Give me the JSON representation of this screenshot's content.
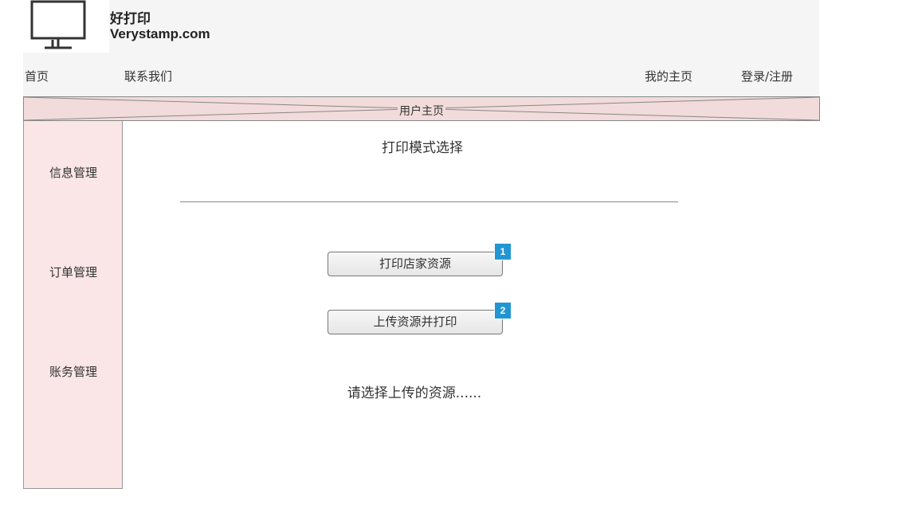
{
  "brand": {
    "name": "好打印",
    "domain": "Verystamp.com",
    "logo_icon": "monitor-icon"
  },
  "nav": {
    "home": "首页",
    "contact": "联系我们",
    "my_page": "我的主页",
    "login": "登录/注册"
  },
  "banner": {
    "label": "用户主页"
  },
  "sidebar": {
    "items": [
      {
        "label": "信息管理"
      },
      {
        "label": "订单管理"
      },
      {
        "label": "账务管理"
      }
    ]
  },
  "main": {
    "title": "打印模式选择",
    "buttons": [
      {
        "label": "打印店家资源",
        "badge": "1"
      },
      {
        "label": "上传资源并打印",
        "badge": "2"
      }
    ],
    "hint": "请选择上传的资源......"
  },
  "colors": {
    "header_bg": "#f5f5f5",
    "banner_bg": "#f2dbdb",
    "sidebar_bg": "#fae6e6",
    "badge": "#2196d3"
  }
}
